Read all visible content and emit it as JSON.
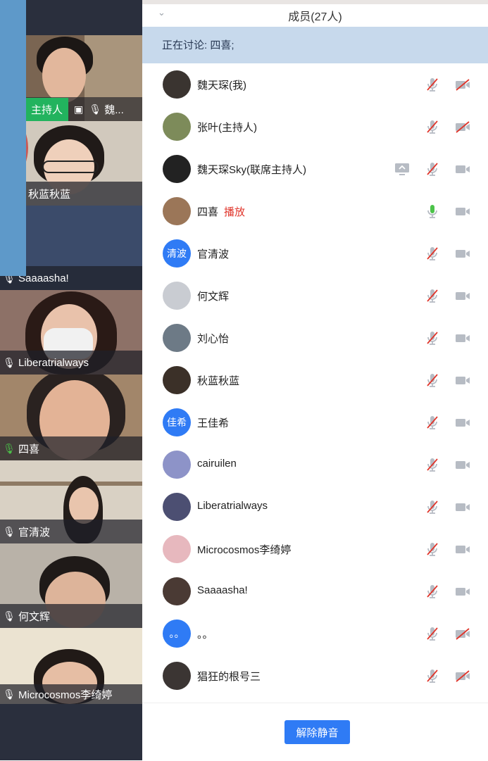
{
  "panel": {
    "title": "成员(27人)",
    "discussion": "正在讨论: 四喜;",
    "unmute_button": "解除静音"
  },
  "members": [
    {
      "name": "魏天琛(我)",
      "extra": "",
      "avatar_text": "",
      "avatar_color": "#3a3430",
      "mic": "muted",
      "cam": "off",
      "share": false
    },
    {
      "name": "张叶(主持人)",
      "extra": "",
      "avatar_text": "",
      "avatar_color": "#7d8b5a",
      "mic": "muted",
      "cam": "off",
      "share": false
    },
    {
      "name": "魏天琛Sky(联席主持人)",
      "extra": "",
      "avatar_text": "",
      "avatar_color": "#222",
      "mic": "muted",
      "cam": "on",
      "share": true
    },
    {
      "name": "四喜",
      "extra": "播放",
      "avatar_text": "",
      "avatar_color": "#9b7658",
      "mic": "active",
      "cam": "on",
      "share": false
    },
    {
      "name": "官清波",
      "extra": "",
      "avatar_text": "清波",
      "avatar_color": "#2f7bf5",
      "mic": "muted",
      "cam": "on",
      "share": false
    },
    {
      "name": "何文辉",
      "extra": "",
      "avatar_text": "",
      "avatar_color": "#c9ccd2",
      "mic": "muted",
      "cam": "on",
      "share": false
    },
    {
      "name": "刘心怡",
      "extra": "",
      "avatar_text": "",
      "avatar_color": "#6d7a86",
      "mic": "muted",
      "cam": "on",
      "share": false
    },
    {
      "name": "秋蓝秋蓝",
      "extra": "",
      "avatar_text": "",
      "avatar_color": "#3b3028",
      "mic": "muted",
      "cam": "on",
      "share": false
    },
    {
      "name": "王佳希",
      "extra": "",
      "avatar_text": "佳希",
      "avatar_color": "#2f7bf5",
      "mic": "muted",
      "cam": "on",
      "share": false
    },
    {
      "name": "cairuilen",
      "extra": "",
      "avatar_text": "",
      "avatar_color": "#8d93c8",
      "mic": "muted",
      "cam": "on",
      "share": false
    },
    {
      "name": "Liberatrialways",
      "extra": "",
      "avatar_text": "",
      "avatar_color": "#4c4f72",
      "mic": "muted",
      "cam": "on",
      "share": false
    },
    {
      "name": "Microcosmos李绮婷",
      "extra": "",
      "avatar_text": "",
      "avatar_color": "#e7b8be",
      "mic": "muted",
      "cam": "on",
      "share": false
    },
    {
      "name": "Saaaasha!",
      "extra": "",
      "avatar_text": "",
      "avatar_color": "#4a3a34",
      "mic": "muted",
      "cam": "on",
      "share": false
    },
    {
      "name": "。。",
      "extra": "",
      "avatar_text": "。。",
      "avatar_color": "#2f7bf5",
      "mic": "muted",
      "cam": "off",
      "share": false
    },
    {
      "name": "猖狂的根号三",
      "extra": "",
      "avatar_text": "",
      "avatar_color": "#3b3533",
      "mic": "muted",
      "cam": "off",
      "share": false
    }
  ],
  "video_tiles": [
    {
      "label": "主持人",
      "badge_text": "主持人",
      "trailing": "魏...",
      "mic": "muted",
      "bg": "#6e5a48"
    },
    {
      "label": "秋蓝秋蓝",
      "mic": "",
      "bg": "#cfc6ba"
    },
    {
      "label": "Saaaasha!",
      "mic": "muted",
      "bg": "#3a4a68"
    },
    {
      "label": "Liberatrialways",
      "mic": "muted",
      "bg": "#8a6d66"
    },
    {
      "label": "四喜",
      "mic": "active",
      "bg": "#a08466"
    },
    {
      "label": "官清波",
      "mic": "muted",
      "bg": "#d9d1c4"
    },
    {
      "label": "何文辉",
      "mic": "muted",
      "bg": "#b8b0a6"
    },
    {
      "label": "Microcosmos李绮婷",
      "mic": "muted",
      "bg": "#e9e1cf"
    }
  ],
  "colors": {
    "accent": "#2f7bf5",
    "muted_red": "#e0352b",
    "mic_active": "#4cc34a",
    "discussion_bg": "#c7d9ec"
  }
}
